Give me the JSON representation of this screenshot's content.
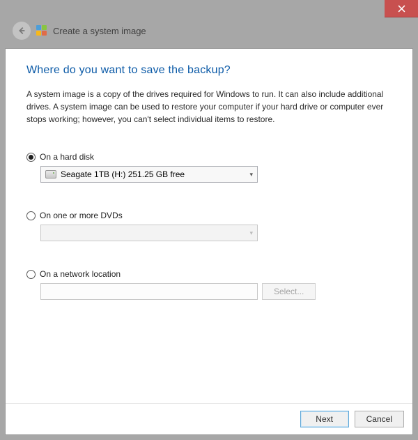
{
  "window": {
    "wizard_title": "Create a system image"
  },
  "page": {
    "heading": "Where do you want to save the backup?",
    "description": "A system image is a copy of the drives required for Windows to run. It can also include additional drives. A system image can be used to restore your computer if your hard drive or computer ever stops working; however, you can't select individual items to restore."
  },
  "options": {
    "hard_disk": {
      "label": "On a hard disk",
      "selected_drive": "Seagate 1TB (H:)  251.25 GB free"
    },
    "dvd": {
      "label": "On one or more DVDs"
    },
    "network": {
      "label": "On a network location",
      "select_button": "Select..."
    }
  },
  "footer": {
    "next": "Next",
    "cancel": "Cancel"
  }
}
